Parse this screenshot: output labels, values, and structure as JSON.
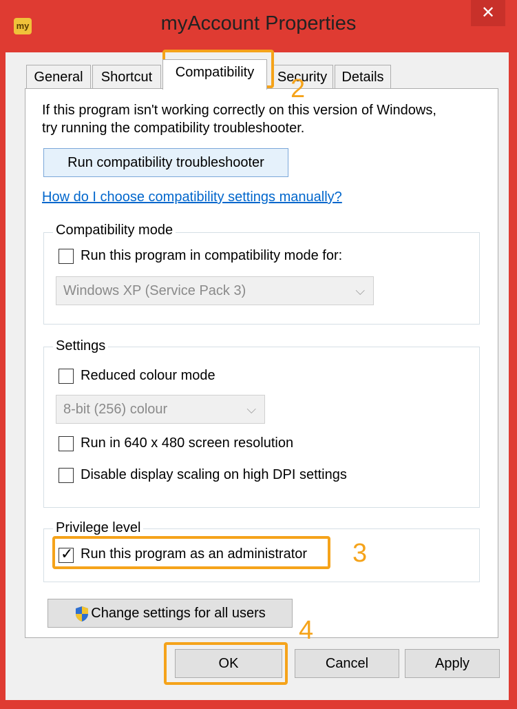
{
  "window": {
    "title": "myAccount Properties",
    "app_icon_text": "my",
    "close_glyph": "✕"
  },
  "tabs": [
    {
      "label": "General"
    },
    {
      "label": "Shortcut"
    },
    {
      "label": "Compatibility",
      "active": true
    },
    {
      "label": "Security"
    },
    {
      "label": "Details"
    }
  ],
  "intro": {
    "line1": "If this program isn't working correctly on this version of Windows,",
    "line2": "try running the compatibility troubleshooter.",
    "run_troubleshooter_label": "Run compatibility troubleshooter",
    "help_link": "How do I choose compatibility settings manually?"
  },
  "compat_mode": {
    "group_label": "Compatibility mode",
    "checkbox_label": "Run this program in compatibility mode for:",
    "checked": false,
    "select_value": "Windows XP (Service Pack 3)"
  },
  "settings": {
    "group_label": "Settings",
    "reduced_colour_label": "Reduced colour mode",
    "reduced_colour_checked": false,
    "colour_select_value": "8-bit (256) colour",
    "res640_label": "Run in 640 x 480 screen resolution",
    "res640_checked": false,
    "dpi_label": "Disable display scaling on high DPI settings",
    "dpi_checked": false
  },
  "privilege": {
    "group_label": "Privilege level",
    "admin_label": "Run this program as an administrator",
    "admin_checked": true
  },
  "change_all_users_label": "Change settings for all users",
  "footer": {
    "ok_label": "OK",
    "cancel_label": "Cancel",
    "apply_label": "Apply"
  },
  "annotations": {
    "step2": "2",
    "step3": "3",
    "step4": "4",
    "highlight_color": "#f5a31a"
  },
  "icons": {
    "chevron": "⌵",
    "check": "✓"
  }
}
